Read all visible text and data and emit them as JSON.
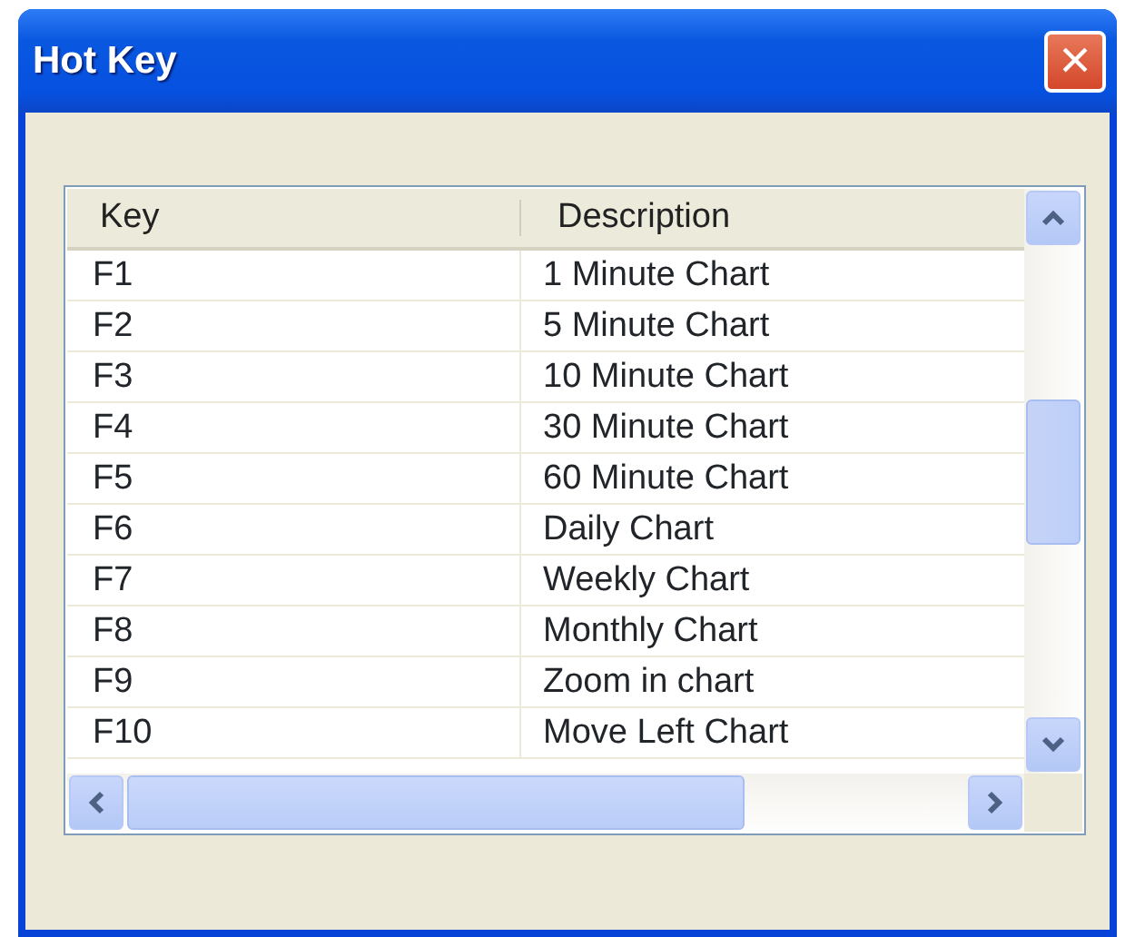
{
  "window": {
    "title": "Hot Key",
    "close": "×"
  },
  "table": {
    "columns": [
      "Key",
      "Description"
    ],
    "rows": [
      {
        "key": "F1",
        "description": "1 Minute Chart"
      },
      {
        "key": "F2",
        "description": "5 Minute Chart"
      },
      {
        "key": "F3",
        "description": "10 Minute Chart"
      },
      {
        "key": "F4",
        "description": "30 Minute Chart"
      },
      {
        "key": "F5",
        "description": "60 Minute Chart"
      },
      {
        "key": "F6",
        "description": "Daily Chart"
      },
      {
        "key": "F7",
        "description": "Weekly Chart"
      },
      {
        "key": "F8",
        "description": "Monthly Chart"
      },
      {
        "key": "F9",
        "description": "Zoom in chart"
      },
      {
        "key": "F10",
        "description": "Move Left Chart"
      }
    ]
  }
}
